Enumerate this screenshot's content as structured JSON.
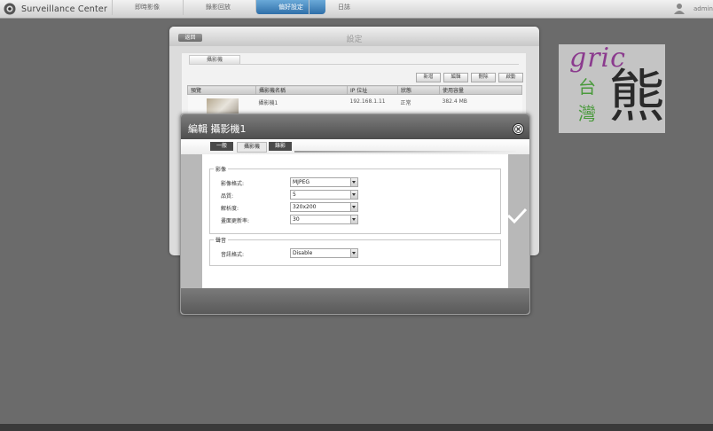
{
  "app": {
    "title": "Surveillance Center"
  },
  "nav": {
    "tabs": [
      {
        "label": "即時影像"
      },
      {
        "label": "錄影回放"
      },
      {
        "label": "偏好設定"
      },
      {
        "label": "日誌"
      }
    ],
    "active_index": 2
  },
  "user": {
    "name": "admin"
  },
  "settings": {
    "title": "設定",
    "back_label": "返回",
    "tab_label": "攝影機",
    "buttons": [
      "新增",
      "編輯",
      "刪除",
      "啟動"
    ],
    "table": {
      "headers": [
        "預覽",
        "攝影機名稱",
        "IP 位址",
        "狀態",
        "使用容量"
      ],
      "rows": [
        {
          "name": "攝影機1",
          "ip": "192.168.1.11",
          "status": "正常",
          "usage": "382.4 MB"
        }
      ]
    }
  },
  "watermark": {
    "text_latin": "gric",
    "text_cjk_1": "台",
    "text_cjk_2": "灣",
    "text_cjk_big": "熊"
  },
  "dialog": {
    "title": "編輯 攝影機1",
    "tabs": [
      {
        "label": "一般"
      },
      {
        "label": "攝影機"
      },
      {
        "label": "錄影"
      }
    ],
    "active_tab_index": 1,
    "video_group": {
      "label": "影像",
      "fields": [
        {
          "label": "影像格式:",
          "value": "MJPEG"
        },
        {
          "label": "品質:",
          "value": "5"
        },
        {
          "label": "解析度:",
          "value": "320x200"
        },
        {
          "label": "畫面更新率:",
          "value": "30"
        }
      ]
    },
    "audio_group": {
      "label": "聲音",
      "fields": [
        {
          "label": "音訊格式:",
          "value": "Disable"
        }
      ]
    }
  },
  "colors": {
    "background": "#6b6b6b",
    "active_tab": "#2f6fa8",
    "watermark_purple": "#8b3b8e",
    "watermark_green": "#4a9a3c"
  }
}
